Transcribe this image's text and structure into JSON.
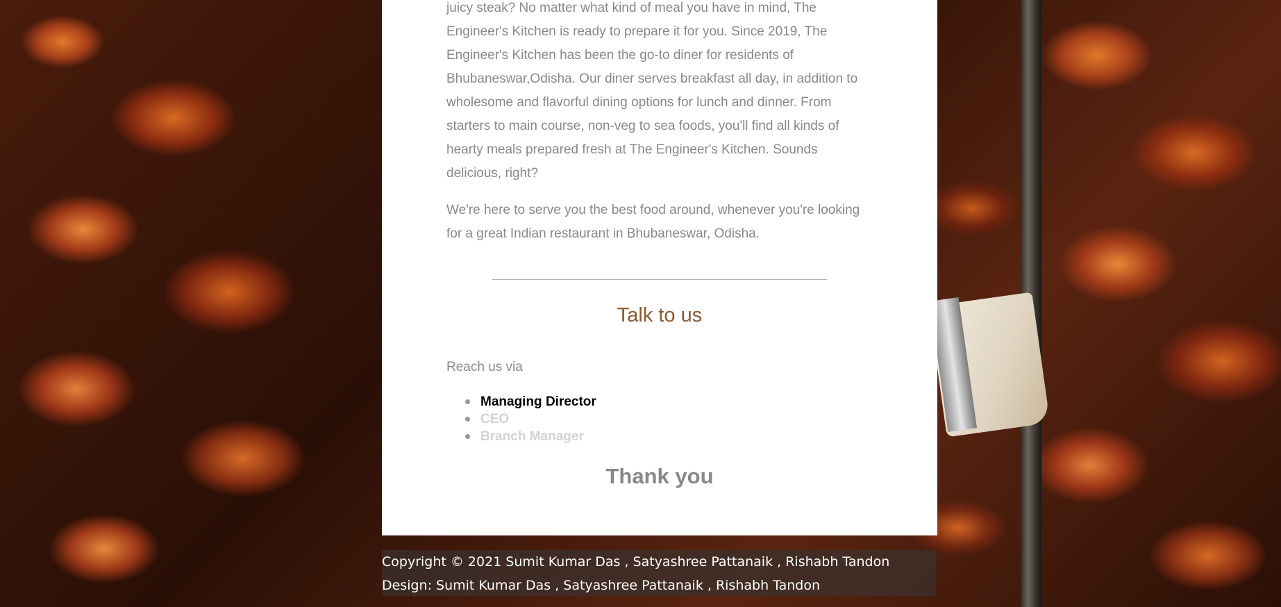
{
  "about": {
    "paragraph_1": "juicy steak? No matter what kind of meal you have in mind, The Engineer's Kitchen is ready to prepare it for you. Since 2019, The Engineer's Kitchen has been the go-to diner for residents of Bhubaneswar,Odisha. Our diner serves breakfast all day, in addition to wholesome and flavorful dining options for lunch and dinner. From starters to main course, non-veg to sea foods, you'll find all kinds of hearty meals prepared fresh at The Engineer's Kitchen. Sounds delicious, right?",
    "paragraph_2": "We're here to serve you the best food around, whenever you're looking for a great Indian restaurant in Bhubaneswar, Odisha."
  },
  "contact": {
    "heading": "Talk to us",
    "reach_label": "Reach us via",
    "items": [
      {
        "label": "Managing Director"
      },
      {
        "label": "CEO"
      },
      {
        "label": "Branch Manager"
      }
    ],
    "thanks": "Thank you"
  },
  "footer": {
    "copyright": "Copyright © 2021 Sumit Kumar Das , Satyashree Pattanaik , Rishabh Tandon",
    "design": "Design: Sumit Kumar Das , Satyashree Pattanaik , Rishabh Tandon"
  },
  "colors": {
    "heading": "#8b5a30",
    "body_text": "#888888",
    "active_contact": "#000000",
    "inactive_contact": "#d3d3d3"
  }
}
